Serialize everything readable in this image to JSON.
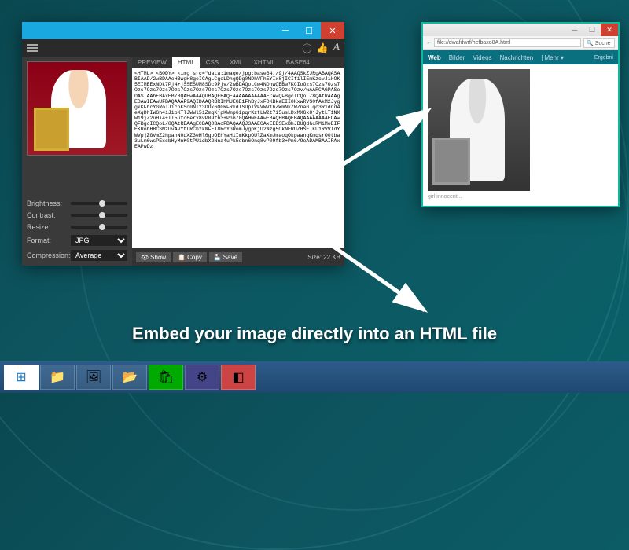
{
  "tagline": "Embed your image directly into an HTML file",
  "app": {
    "tabs": [
      "PREVIEW",
      "HTML",
      "CSS",
      "XML",
      "XHTML",
      "BASE64"
    ],
    "active_tab": "HTML",
    "controls": {
      "brightness": "Brightness:",
      "contrast": "Contrast:",
      "resize": "Resize:",
      "format": "Format:",
      "format_value": "JPG",
      "compression": "Compression:",
      "compression_value": "Average"
    },
    "buttons": {
      "show": "Show",
      "copy": "Copy",
      "save": "Save"
    },
    "size_label": "Size: 22 KB",
    "code": "<HTML> <BODY> <img src=\"data:image/jpg;base64,/9j/4AAQSkZJRgABAQASABIAAD/2wBDAAoHBwgH8goICAgLCgoLDhgQDg0NDhVFhEYIx8jICIfilIEmKzcvJikOK5EIMEExNDk7Pj4+jSSESUM8SDc9Pjv/2wBDAQoLCw4NDhwQEBw7KCIoOzs7Ozs7Ozs7Ozs7Ozs7Ozs7Ozs7Ozs7Ozs7Ozs7Ozs7Ozs7Ozs7Ozs7Ozs7Ozs7Ozv/wAARCAGPASoDASIAAhEBAxEB/8QAHwAAAQUBAQEBAQEAAAAAAAAAAAECAwQFBgcICQoL/8QAtRAAAgEDAwIEAwUFBAQAAAF9AQIDAAQRBRIhMUEGE1FhByJxFDKBkaEII0KxwRVS0fAkM2JyggkKFhcYGRolJicoKSo0NTY3ODk6Q0RFRkdISUpTVFVWV1hZWmNkZWZnaGlqc3R1dnd4eXqDhIWGh4iJipKTlJWWl5iZmqKjpKWmp6ipqrKztLW2t7i5usLDxMXGx8jJytLT1NXW19jZ2uHi4+Tl5ufo6erx8vP09fb3+Pn6/8QAHwEAAwEBAQEBAQEBAQAAAAAAAAECAwQFBgcICQoL/8QAtREAAgECBAQDBAcFBAQAAQJ3AAECAxEEBSExBhJBUQdhcRMiMoEIFEKRobHBCSMzUvAVYtLRChYkNFEl8RcYGRomJygpKjU2Nzg5OkNERUZHSElKU1RVVldYWVpjZGVmZ2hpanN0dXZ3eHl6goOEhYaHiImKkpOUlZaXmJmaoqOkpaanqKmqsrO0tba3uLm6wsPExcbHyMnK0tPU1dbX2Nna4uPk5ebn6Onq8vP09fb3+Pn6/9oADAMBAAIRAxEAPwDz"
  },
  "browser": {
    "url": "file://dwafdwrf/hefbaxo8A.html",
    "search_placeholder": "Suche",
    "tabs": {
      "web": "Web",
      "bilder": "Bilder",
      "videos": "Videos",
      "nachrichten": "Nachrichten",
      "mehr": "| Mehr ▾"
    },
    "results_label": "Ergebni",
    "caption": "girl.innocent..."
  },
  "taskbar": {
    "items": [
      "start",
      "explorer",
      "gallery",
      "folder",
      "store",
      "settings",
      "app"
    ]
  }
}
